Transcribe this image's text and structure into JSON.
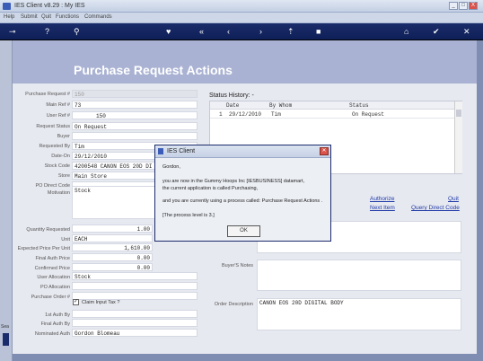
{
  "window": {
    "title": "IES Client v8.29 : My IES",
    "min_label": "_",
    "max_label": "□",
    "close_label": "X"
  },
  "menu": [
    "Help",
    "Submit",
    "Quit",
    "Functions",
    "Commands"
  ],
  "toolbar_icons": [
    "key-icon",
    "help-icon",
    "search-icon",
    "favorite-icon",
    "rewind-icon",
    "back-icon",
    "forward-icon",
    "upload-icon",
    "stop-icon",
    "home-icon",
    "confirm-icon",
    "close-icon"
  ],
  "header": {
    "title": "Purchase Request Actions"
  },
  "fields": {
    "purchase_request": {
      "label": "Purchase Request #",
      "value": "150"
    },
    "main_ref": {
      "label": "Main Ref #",
      "value": "73"
    },
    "user_ref": {
      "label": "User Ref #",
      "value": "150"
    },
    "request_status": {
      "label": "Request Status",
      "value": "On Request"
    },
    "buyer": {
      "label": "Buyer",
      "value": ""
    },
    "requested_by": {
      "label": "Requested By",
      "value": "Tim"
    },
    "date_on": {
      "label": "Date-On",
      "value": "29/12/2010"
    },
    "stock_code": {
      "label": "Stock Code",
      "value": "4200548 CANON EOS 20D DI"
    },
    "store": {
      "label": "Store",
      "value": "Main Store"
    },
    "po_direct_code": {
      "label": "PO Direct Code",
      "value": ""
    },
    "motivation": {
      "label": "Motivation",
      "value": "Stock"
    },
    "quantity_requested": {
      "label": "Quantity Requested",
      "value": "1.00"
    },
    "unit": {
      "label": "Unit",
      "value": "EACH"
    },
    "expected_price": {
      "label": "Expected Price Per Unit",
      "value": "1,610.00"
    },
    "final_auth_price": {
      "label": "Final Auth Price",
      "value": "0.00"
    },
    "confirmed_price": {
      "label": "Confirmed Price",
      "value": "0.00"
    },
    "user_allocation": {
      "label": "User Allocation",
      "value": "Stock"
    },
    "po_allocation": {
      "label": "PO Allocation",
      "value": ""
    },
    "purchase_order": {
      "label": "Purchase Order #",
      "value": ""
    },
    "claim_input_tax": {
      "label": "Claim Input Tax ?"
    },
    "first_auth_by": {
      "label": "1st Auth By",
      "value": ""
    },
    "final_auth_by": {
      "label": "Final Auth By",
      "value": ""
    },
    "nominated_auth": {
      "label": "Nominated Auth",
      "value": "Gordon Blomeau"
    },
    "buyers_notes": {
      "label": "Buyer'S Notes",
      "value": ""
    },
    "order_description": {
      "label": "Order Description",
      "value": "CANON EOS 20D DIGITAL BODY"
    }
  },
  "status_history": {
    "title": "Status History: -",
    "columns": [
      "Date",
      "By Whom",
      "Status"
    ],
    "rows": [
      {
        "num": "1",
        "date": "29/12/2010",
        "by": "Tim",
        "status": "On Request"
      }
    ]
  },
  "actions": {
    "authorize": "Authorize",
    "quit": "Quit",
    "next_item": "Next Item",
    "query_direct_code": "Query Direct Code"
  },
  "dialog": {
    "title": "IES Client",
    "line1": "Gordon,",
    "line2": "you are now in the Gummy Hoops Inc [IESBUSINESS] datamart,",
    "line3": "the current application is called Purchasing,",
    "line4": "and you are currently using a process called: Purchase Request Actions .",
    "line5": "[The process level is 3.]",
    "ok": "OK"
  },
  "sidebar_text": "Sea"
}
